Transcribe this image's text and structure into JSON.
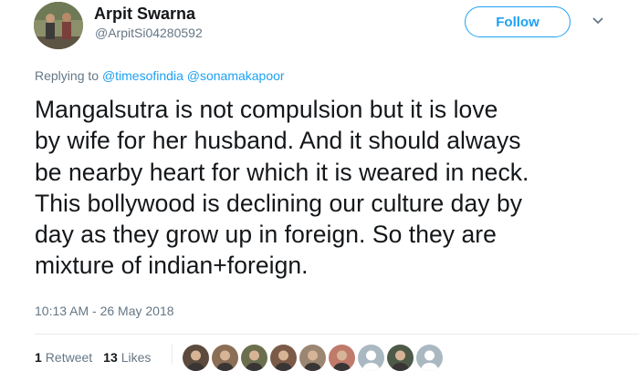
{
  "author": {
    "name": "Arpit Swarna",
    "handle": "@ArpitSi04280592",
    "avatar_icon": "profile-photo"
  },
  "follow_button": {
    "label": "Follow",
    "color": "#1da1f2"
  },
  "menu_icon": "chevron-down-icon",
  "reply": {
    "prefix": "Replying to",
    "mentions": [
      "@timesofindia",
      "@sonamakapoor"
    ]
  },
  "tweet": {
    "lines": [
      "Mangalsutra is not compulsion but it is love",
      "by wife for her husband. And it should always",
      "be nearby heart for which it is weared in neck.",
      "This bollywood is declining our culture day by",
      "day as they grow up in foreign. So they are",
      "mixture of indian+foreign."
    ],
    "timestamp": "10:13 AM - 26 May 2018"
  },
  "stats": {
    "retweets_count": "1",
    "retweets_label": "Retweet",
    "likes_count": "13",
    "likes_label": "Likes"
  },
  "likers": [
    {
      "name": "liker-avatar-1",
      "color": "#5c4a3d"
    },
    {
      "name": "liker-avatar-2",
      "color": "#8a6e55"
    },
    {
      "name": "liker-avatar-3",
      "color": "#6b6f4e"
    },
    {
      "name": "liker-avatar-4",
      "color": "#7b5a48"
    },
    {
      "name": "liker-avatar-5",
      "color": "#9b8672"
    },
    {
      "name": "liker-avatar-6",
      "color": "#c07a6a"
    },
    {
      "name": "liker-avatar-7",
      "color": "#aab8c2"
    },
    {
      "name": "liker-avatar-8",
      "color": "#4e5a48"
    },
    {
      "name": "liker-avatar-9",
      "color": "#aab8c2"
    }
  ],
  "colors": {
    "accent": "#1da1f2",
    "text": "#14171a",
    "muted": "#657786",
    "divider": "#e6ecf0"
  }
}
